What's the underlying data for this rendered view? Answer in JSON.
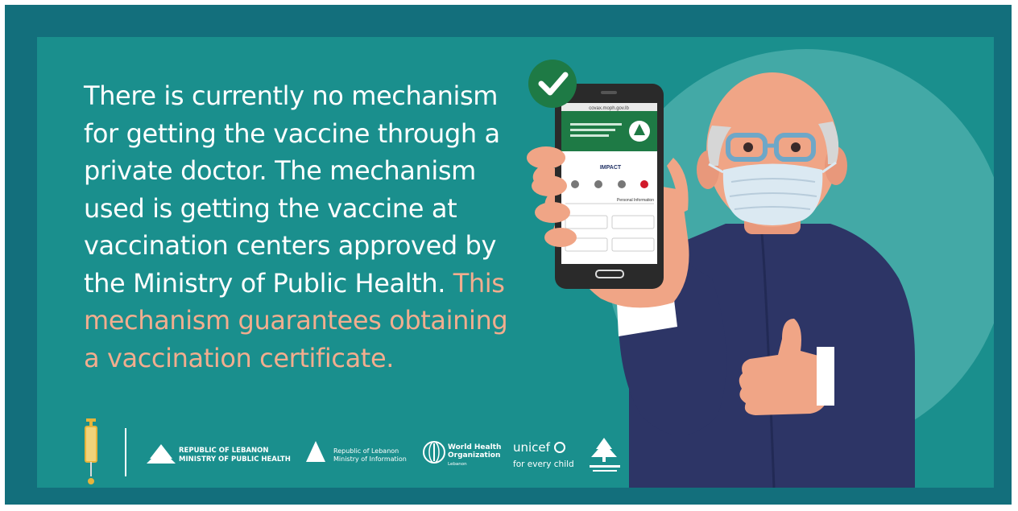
{
  "message": {
    "white_text": "There is currently no mechanism for getting the vaccine through a private doctor. The mechanism used is getting the vaccine at vaccination centers approved by the Ministry of Public Health.",
    "highlight_text": "This mechanism guarantees obtaining a vaccination certificate."
  },
  "phone": {
    "url": "covax.moph.gov.lb",
    "app_name": "IMPACT",
    "section_title": "Personal Information"
  },
  "logos": {
    "moph_line1": "REPUBLIC OF LEBANON",
    "moph_line2": "MINISTRY OF PUBLIC HEALTH",
    "moi_line1": "Republic of Lebanon",
    "moi_line2": "Ministry of Information",
    "who_line1": "World Health",
    "who_line2": "Organization",
    "who_line3": "Lebanon",
    "unicef_name": "unicef",
    "unicef_tagline": "for every child"
  },
  "colors": {
    "frame": "#136f7c",
    "panel": "#1a8f8d",
    "circle": "#43a9a6",
    "highlight": "#f2ad8e",
    "shirt": "#2d3566",
    "check_badge": "#1e7a45"
  },
  "icons": [
    "check-icon",
    "syringe-icon",
    "cedar-icon",
    "who-emblem-icon",
    "unicef-emblem-icon"
  ]
}
